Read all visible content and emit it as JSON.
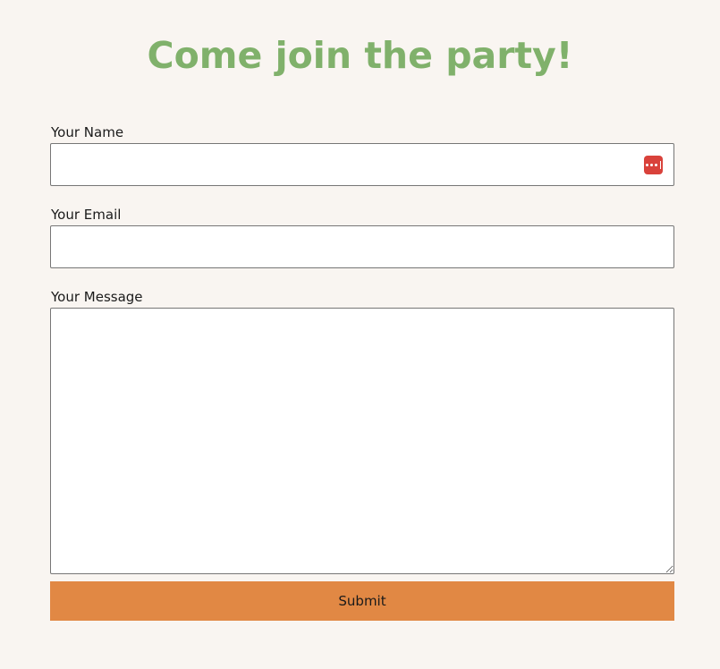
{
  "header": {
    "title": "Come join the party!"
  },
  "form": {
    "name_label": "Your Name",
    "name_value": "",
    "email_label": "Your Email",
    "email_value": "",
    "message_label": "Your Message",
    "message_value": "",
    "submit_label": "Submit"
  },
  "icons": {
    "password_manager": "password-manager-icon"
  },
  "colors": {
    "background": "#f9f5f1",
    "title": "#80b16b",
    "button": "#e18844",
    "password_icon": "#d9423b"
  }
}
